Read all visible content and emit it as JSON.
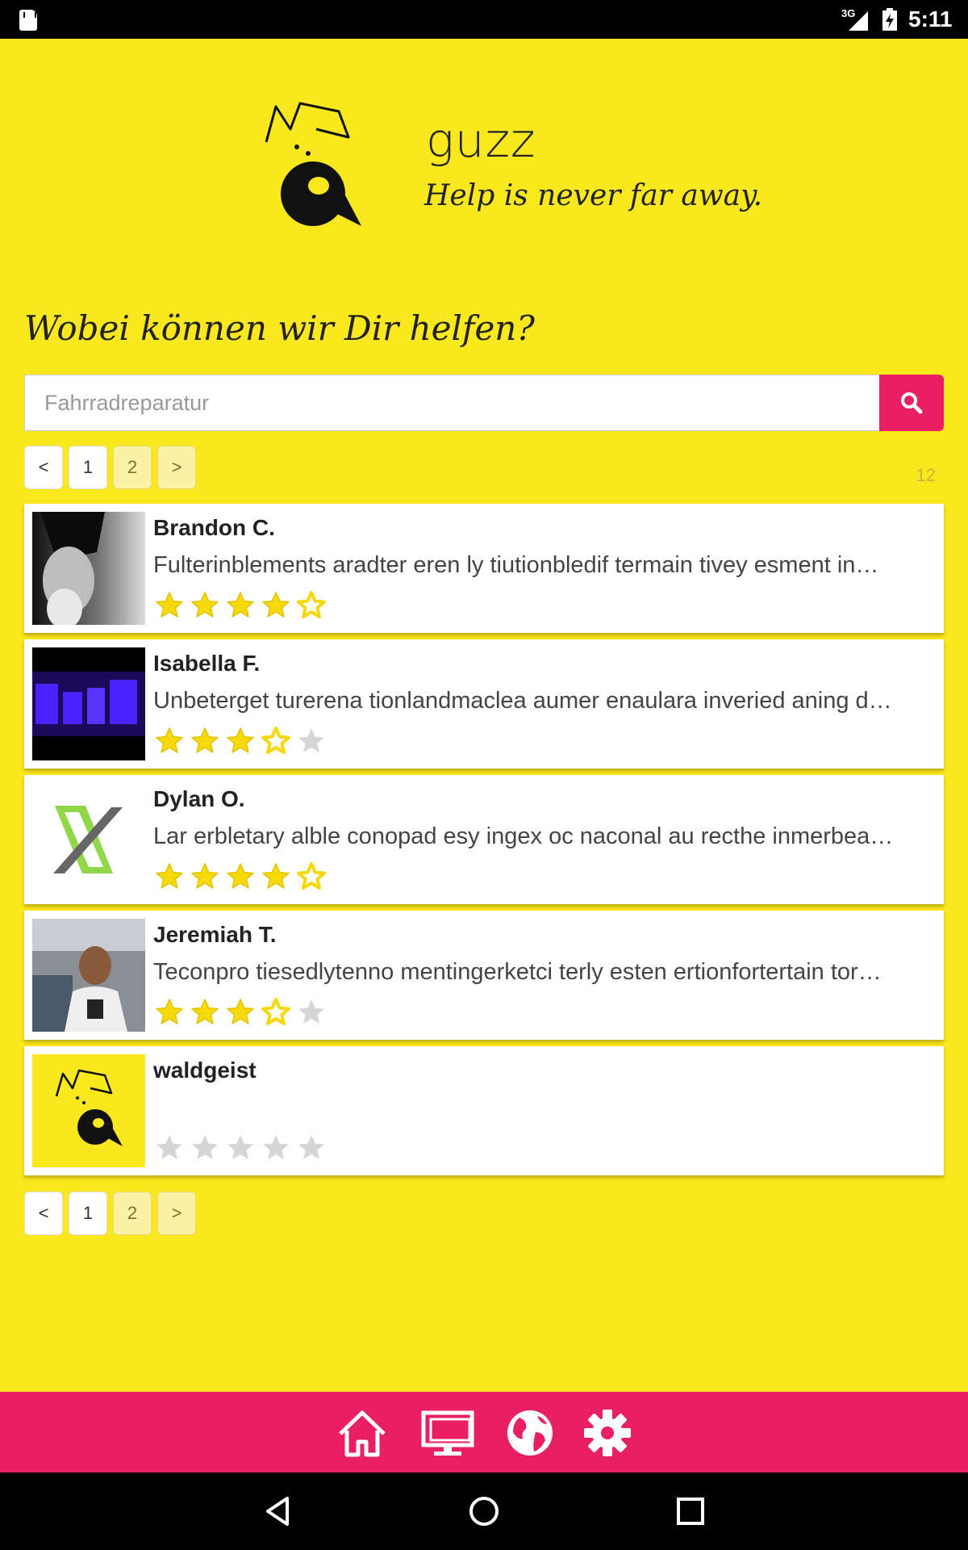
{
  "status_bar": {
    "network": "3G",
    "time": "5:11",
    "icons": [
      "sd-card-icon",
      "signal-icon",
      "battery-icon"
    ]
  },
  "header": {
    "app_name": "guzz",
    "tagline": "Help is never far away."
  },
  "question": "Wobei können wir Dir helfen?",
  "search": {
    "placeholder": "Fahrradreparatur",
    "button_icon": "search-icon"
  },
  "pagination": {
    "prev": "<",
    "pages": [
      "1",
      "2"
    ],
    "active_page": "2",
    "next": ">",
    "result_count": "12"
  },
  "results": [
    {
      "name": "Brandon C.",
      "description": "Fulterinblements aradter eren ly tiutionbledif termain tivey esment in…",
      "rating": 4.5,
      "avatar": "grayscale-portrait"
    },
    {
      "name": "Isabella F.",
      "description": "Unbeterget turerena tionlandmaclea aumer enaulara inveried aning d…",
      "rating": 3.5,
      "avatar": "pixel-logo"
    },
    {
      "name": "Dylan O.",
      "description": "Lar erbletary alble conopad esy ingex oc naconal au recthe inmerbea…",
      "rating": 4.5,
      "avatar": "x-logo"
    },
    {
      "name": "Jeremiah T.",
      "description": "Teconpro tiesedlytenno mentingerketci terly esten ertionfortertain tor…",
      "rating": 3.5,
      "avatar": "office-portrait"
    },
    {
      "name": "waldgeist",
      "description": "",
      "rating": 0,
      "avatar": "guzz-logo"
    }
  ],
  "bottom_bar": {
    "icons": [
      "home-icon",
      "monitor-icon",
      "globe-icon",
      "settings-icon"
    ]
  },
  "nav_bar": {
    "icons": [
      "back-icon",
      "home-circle-icon",
      "recents-icon"
    ]
  },
  "colors": {
    "background": "#f9e81d",
    "accent": "#e91e63",
    "star_filled": "#f5d90a",
    "star_empty": "#d6d6d6"
  }
}
